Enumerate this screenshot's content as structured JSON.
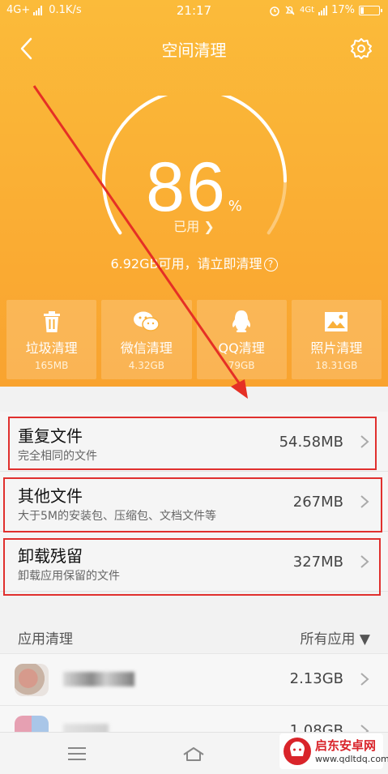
{
  "status_bar": {
    "network": "4G+",
    "speed": "0.1K/s",
    "time": "21:17",
    "network2": "4Gt",
    "battery": "17%"
  },
  "nav": {
    "title": "空间清理",
    "back_icon": "back-icon",
    "settings_icon": "gear-icon"
  },
  "storage": {
    "percent": "86",
    "percent_sign": "%",
    "used_label": "已用",
    "used_fraction": 0.86,
    "free_text": "6.92GB可用，请立即清理"
  },
  "tiles": [
    {
      "label": "垃圾清理",
      "size": "165MB",
      "icon": "trash-icon"
    },
    {
      "label": "微信清理",
      "size": "4.32GB",
      "icon": "wechat-icon"
    },
    {
      "label": "QQ清理",
      "size": "79GB",
      "icon": "qq-icon"
    },
    {
      "label": "照片清理",
      "size": "18.31GB",
      "icon": "photo-icon"
    }
  ],
  "list": [
    {
      "title": "重复文件",
      "subtitle": "完全相同的文件",
      "value": "54.58MB"
    },
    {
      "title": "其他文件",
      "subtitle": "大于5M的安装包、压缩包、文档文件等",
      "value": "267MB"
    },
    {
      "title": "卸载残留",
      "subtitle": "卸载应用保留的文件",
      "value": "327MB"
    }
  ],
  "app_section": {
    "title": "应用清理",
    "filter": "所有应用 ▼",
    "apps": [
      {
        "value": "2.13GB"
      },
      {
        "value": "1.08GB"
      }
    ]
  },
  "watermark": {
    "name": "启东安卓网",
    "url": "www.qdltdq.com"
  },
  "colors": {
    "header_top": "#fbbb3a",
    "header_bottom": "#f9a32f",
    "highlight": "#e0302e"
  }
}
